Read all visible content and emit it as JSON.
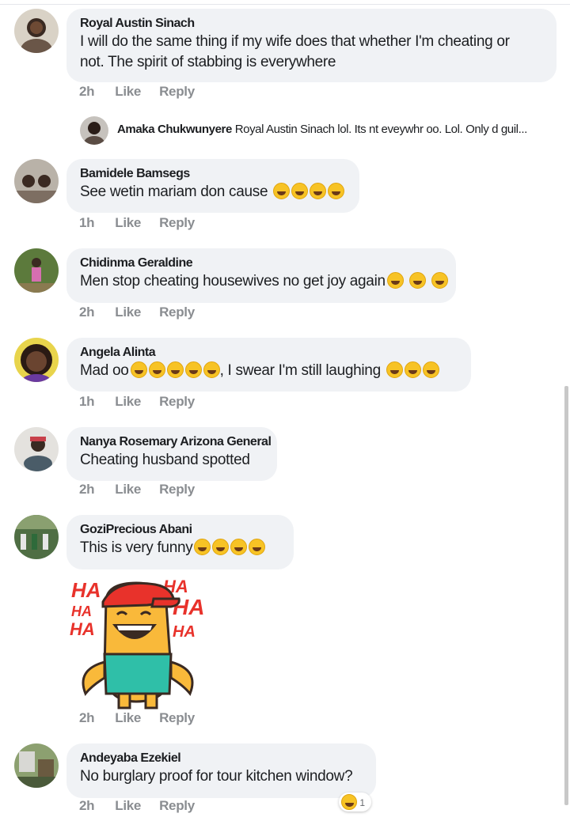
{
  "comments": [
    {
      "name": "Royal Austin Sinach",
      "text": "I will do the same thing if my wife does that whether I'm cheating or",
      "text2": "not. The spirit of stabbing is everywhere",
      "time": "2h",
      "like": "Like",
      "reply": "Reply"
    },
    {
      "name": "Bamidele Bamsegs",
      "text": "See wetin mariam don cause",
      "time": "1h",
      "like": "Like",
      "reply": "Reply"
    },
    {
      "name": "Chidinma Geraldine",
      "text": "Men stop cheating housewives no get joy again",
      "time": "2h",
      "like": "Like",
      "reply": "Reply"
    },
    {
      "name": "Angela Alinta",
      "text": "Mad oo",
      "text_after": ", I swear I'm still laughing",
      "time": "1h",
      "like": "Like",
      "reply": "Reply"
    },
    {
      "name": "Nanya Rosemary Arizona General",
      "text": "Cheating husband spotted",
      "time": "2h",
      "like": "Like",
      "reply": "Reply"
    },
    {
      "name": "GoziPrecious Abani",
      "text": "This is very funny",
      "time": "2h",
      "like": "Like",
      "reply": "Reply"
    },
    {
      "name": "Andeyaba Ezekiel",
      "text": "No  burglary proof for tour kitchen window?",
      "time": "2h",
      "like": "Like",
      "reply": "Reply",
      "reaction_count": "1"
    }
  ],
  "reply": {
    "name": "Amaka Chukwunyere",
    "text": "Royal Austin Sinach lol. Its nt eveywhr oo. Lol. Only d guil..."
  },
  "sticker": {
    "haha_left": [
      "HA",
      "HA",
      "HA"
    ],
    "haha_right": [
      "HA",
      "HA",
      "HA"
    ]
  },
  "colors": {
    "bubble": "#f0f2f5",
    "meta": "#8a8d91",
    "text": "#1c1e21",
    "emoji": "#f7c325"
  }
}
